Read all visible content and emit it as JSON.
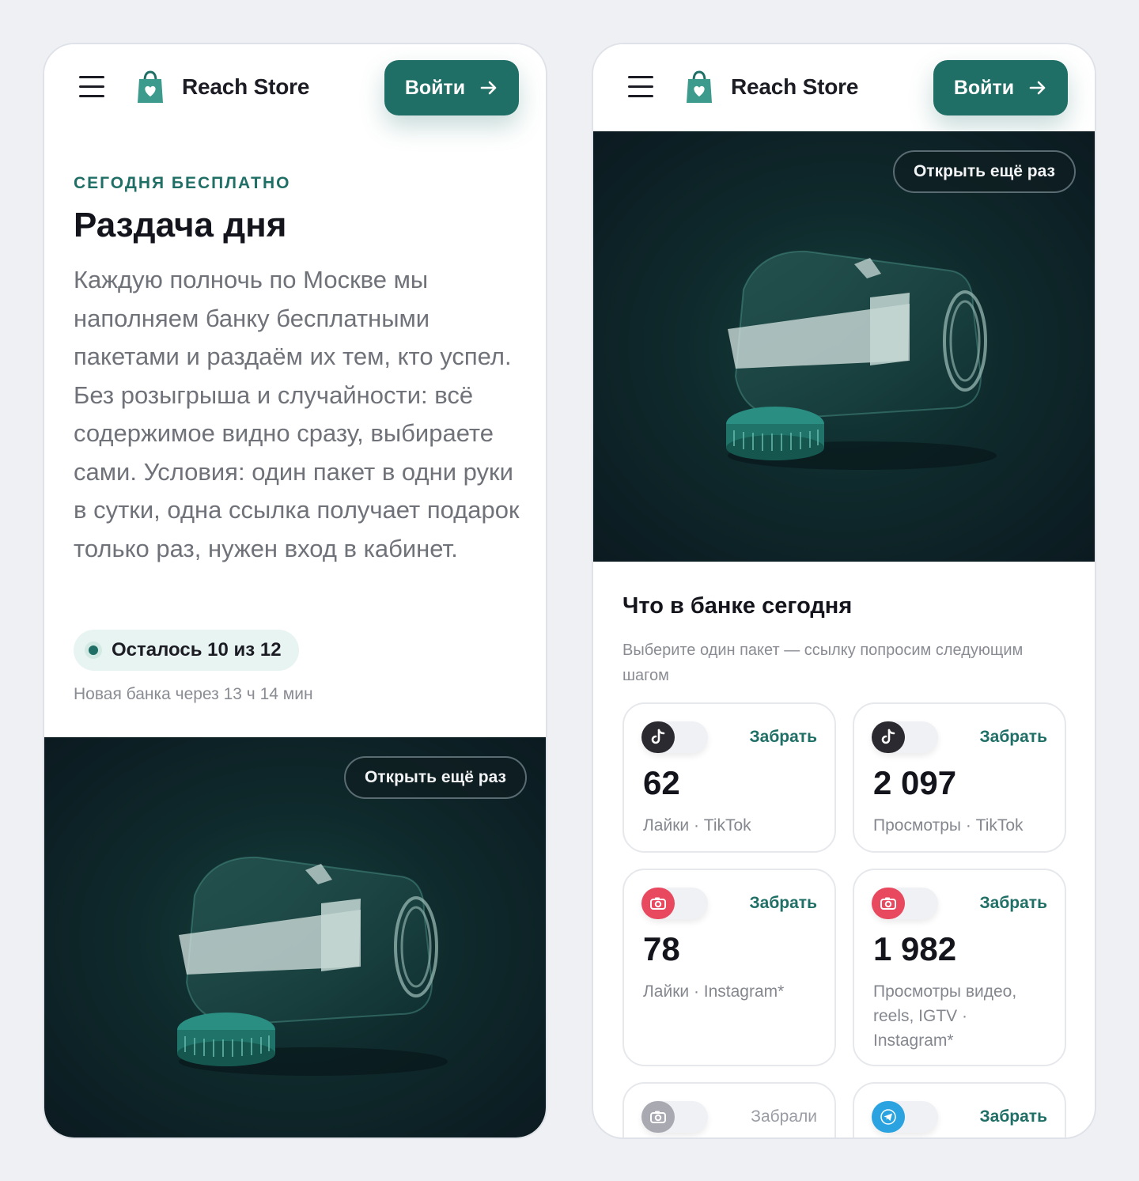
{
  "header": {
    "brand": "Reach Store",
    "login_label": "Войти"
  },
  "left": {
    "eyebrow": "СЕГОДНЯ БЕСПЛАТНО",
    "headline": "Раздача дня",
    "description": "Каждую полночь по Москве мы наполняем банку бесплатными пакетами и раздаём их тем, кто успел. Без розыгрыша и случайности: всё содержимое видно сразу, выбираете сами. Условия: один пакет в одни руки в сутки, одна ссылка получает подарок только раз, нужен вход в кабинет.",
    "remaining": "Осталось 10 из 12",
    "next_jar": "Новая банка через 13 ч 14 мин",
    "reopen_label": "Открыть ещё раз"
  },
  "right": {
    "reopen_label": "Открыть ещё раз",
    "section_title": "Что в банке сегодня",
    "section_sub": "Выберите один пакет — ссылку попросим следующим шагом",
    "cards": [
      {
        "platform": "tiktok",
        "icon": "tiktok-icon",
        "action": "Забрать",
        "value": "62",
        "label": "Лайки · TikTok"
      },
      {
        "platform": "tiktok",
        "icon": "tiktok-icon",
        "action": "Забрать",
        "value": "2 097",
        "label": "Просмотры · TikTok"
      },
      {
        "platform": "instagram",
        "icon": "camera-icon",
        "action": "Забрать",
        "value": "78",
        "label": "Лайки · Instagram*"
      },
      {
        "platform": "instagram",
        "icon": "camera-icon",
        "action": "Забрать",
        "value": "1 982",
        "label": "Просмотры видео, reels, IGTV · Instagram*"
      },
      {
        "platform": "instagram",
        "icon": "camera-icon",
        "action": "Забрали",
        "value": "",
        "label": ""
      },
      {
        "platform": "telegram",
        "icon": "telegram-icon",
        "action": "Забрать",
        "value": "",
        "label": ""
      }
    ]
  },
  "colors": {
    "accent": "#1f6f66",
    "background": "#eff0f4",
    "media_dark": "#0f2a2c",
    "instagram": "#e8495f",
    "telegram": "#2aa3e0"
  }
}
